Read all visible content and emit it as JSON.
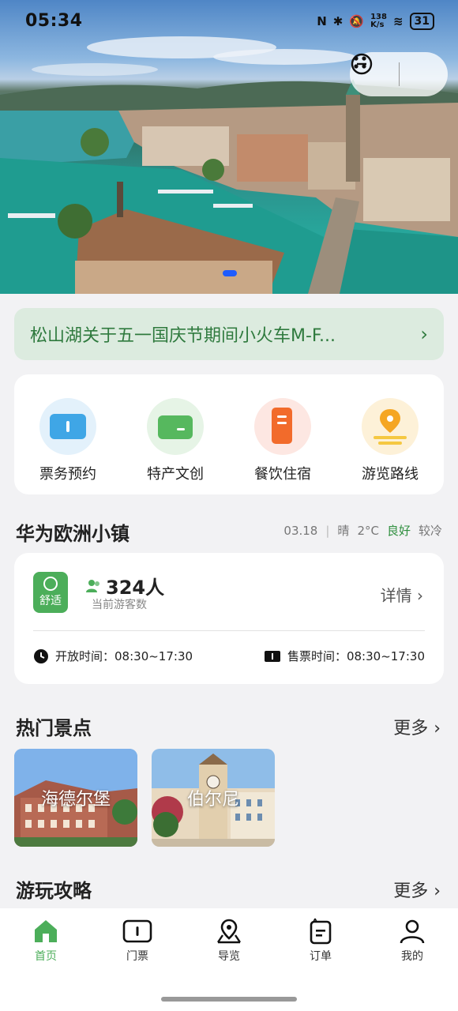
{
  "status_bar": {
    "time": "05:34",
    "network_speed": "138\nK/s",
    "battery": "31"
  },
  "hero": {
    "image_description_icon": "city-lake-photo"
  },
  "notice": {
    "text": "松山湖关于五一国庆节期间小火车M-F...",
    "arrow": "›"
  },
  "services": [
    {
      "label": "票务预约",
      "icon": "ticket-icon",
      "color": "#3fa6e6"
    },
    {
      "label": "特产文创",
      "icon": "wallet-icon",
      "color": "#56b85e"
    },
    {
      "label": "餐饮住宿",
      "icon": "food-icon",
      "color": "#f26b2b"
    },
    {
      "label": "游览路线",
      "icon": "route-icon",
      "color": "#f5b82a"
    }
  ],
  "scenic": {
    "title": "华为欧洲小镇",
    "date": "03.18",
    "separator": "|",
    "weather": "晴",
    "temperature": "2°C",
    "air": "良好",
    "feel": "较冷"
  },
  "crowd": {
    "comfort": "舒适",
    "count": "324人",
    "count_label": "当前游客数",
    "detail": "详情 ›",
    "open_label": "开放时间：",
    "open_time": "08:30~17:30",
    "sale_label": "售票时间：",
    "sale_time": "08:30~17:30"
  },
  "hot_spots": {
    "title": "热门景点",
    "more": "更多 ›",
    "items": [
      {
        "name": "海德尔堡"
      },
      {
        "name": "伯尔尼"
      }
    ]
  },
  "guides": {
    "title": "游玩攻略",
    "more": "更多 ›"
  },
  "tabs": [
    {
      "label": "首页",
      "active": true
    },
    {
      "label": "门票",
      "active": false
    },
    {
      "label": "导览",
      "active": false
    },
    {
      "label": "订单",
      "active": false
    },
    {
      "label": "我的",
      "active": false
    }
  ],
  "colors": {
    "accent": "#4cae5a",
    "notice_bg": "#dcebdf",
    "notice_text": "#2f7a3e",
    "page_bg": "#f2f2f4"
  }
}
